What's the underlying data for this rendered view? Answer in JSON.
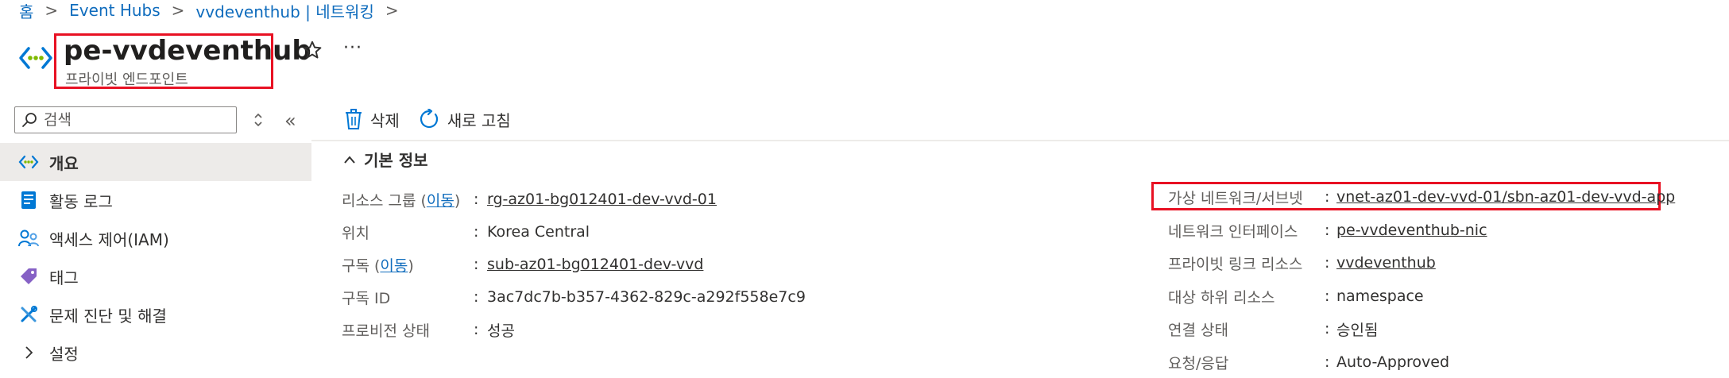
{
  "breadcrumb": {
    "home": "홈",
    "hubs": "Event Hubs",
    "namespace": "vvdeventhub | 네트워킹",
    "sep": ">"
  },
  "header": {
    "title": "pe-vvdeventhub",
    "subtitle": "프라이빗 엔드포인트",
    "more": "···"
  },
  "sidebar": {
    "search_placeholder": "검색",
    "collapse": "«",
    "items": [
      {
        "label": "개요",
        "icon": "endpoint-icon",
        "active": true
      },
      {
        "label": "활동 로그",
        "icon": "log-icon"
      },
      {
        "label": "액세스 제어(IAM)",
        "icon": "iam-icon"
      },
      {
        "label": "태그",
        "icon": "tag-icon"
      },
      {
        "label": "문제 진단 및 해결",
        "icon": "wrench-icon"
      },
      {
        "label": "설정",
        "icon": "chevron-right-icon"
      }
    ]
  },
  "toolbar": {
    "delete": "삭제",
    "refresh": "새로 고침"
  },
  "essentials": {
    "heading": "기본 정보",
    "left": [
      {
        "label": "리소스 그룹 (",
        "link_label": "이동",
        "label_end": ")",
        "value": "rg-az01-bg012401-dev-vvd-01",
        "is_link": true
      },
      {
        "label": "위치",
        "value": "Korea Central",
        "is_link": false
      },
      {
        "label": "구독 (",
        "link_label": "이동",
        "label_end": ")",
        "value": "sub-az01-bg012401-dev-vvd",
        "is_link": true
      },
      {
        "label": "구독 ID",
        "value": "3ac7dc7b-b357-4362-829c-a292f558e7c9",
        "is_link": false
      },
      {
        "label": "프로비전 상태",
        "value": "성공",
        "is_link": false
      }
    ],
    "right": [
      {
        "label": "가상 네트워크/서브넷",
        "value": "vnet-az01-dev-vvd-01/sbn-az01-dev-vvd-app",
        "is_link": true
      },
      {
        "label": "네트워크 인터페이스",
        "value": "pe-vvdeventhub-nic",
        "is_link": true
      },
      {
        "label": "프라이빗 링크 리소스",
        "value": "vvdeventhub",
        "is_link": true
      },
      {
        "label": "대상 하위 리소스",
        "value": "namespace",
        "is_link": false
      },
      {
        "label": "연결 상태",
        "value": "승인됨",
        "is_link": false
      },
      {
        "label": "요청/응답",
        "value": "Auto-Approved",
        "is_link": false
      }
    ],
    "colon": ":"
  },
  "colors": {
    "accent": "#0f6cbd",
    "highlight": "#e81123",
    "active_bg": "#edebe9"
  }
}
